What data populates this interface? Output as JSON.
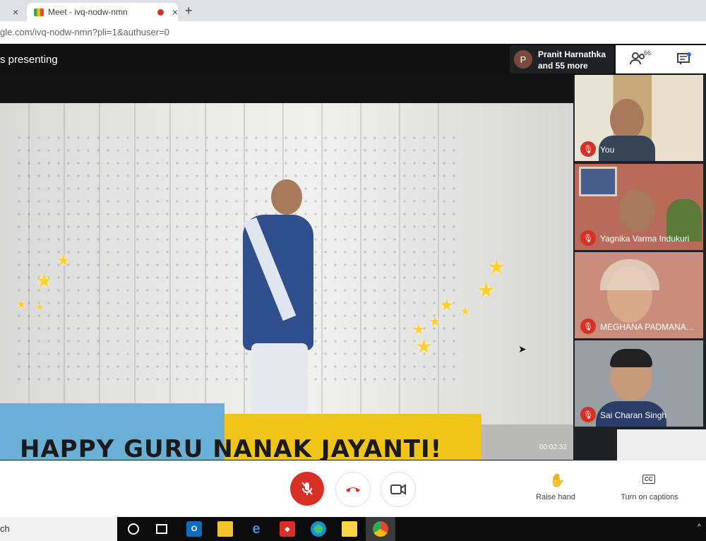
{
  "browser": {
    "prev_tab_close": "×",
    "active_tab_title": "Meet - ivq-nodw-nmn",
    "active_tab_close": "×",
    "new_tab": "+",
    "url": "gle.com/ivq-nodw-nmn?pli=1&authuser=0"
  },
  "meet": {
    "presenting_label": "s presenting",
    "presenter_initial": "P",
    "presenter_name": "Pranit Harnathka",
    "presenter_more": "and 55 more",
    "participant_count": "66"
  },
  "presentation": {
    "banner_text": "HAPPY GURU NANAK JAYANTI!",
    "timestamp": "00:02:32"
  },
  "participants": [
    {
      "name": "You",
      "muted": true
    },
    {
      "name": "Yagnika Varma Indukuri",
      "muted": true
    },
    {
      "name": "MEGHANA PADMANA...",
      "muted": true
    },
    {
      "name": "Sai Charan Singh",
      "muted": true
    }
  ],
  "controls": {
    "raise_hand_label": "Raise hand",
    "captions_label": "Turn on captions",
    "captions_icon_text": "CC"
  },
  "taskbar": {
    "search_text": "ch"
  },
  "colors": {
    "mic_off_red": "#d93025",
    "banner_yellow": "#f0c419",
    "banner_blue": "#6ab0d6",
    "taskbar": "#0b0b0b"
  }
}
